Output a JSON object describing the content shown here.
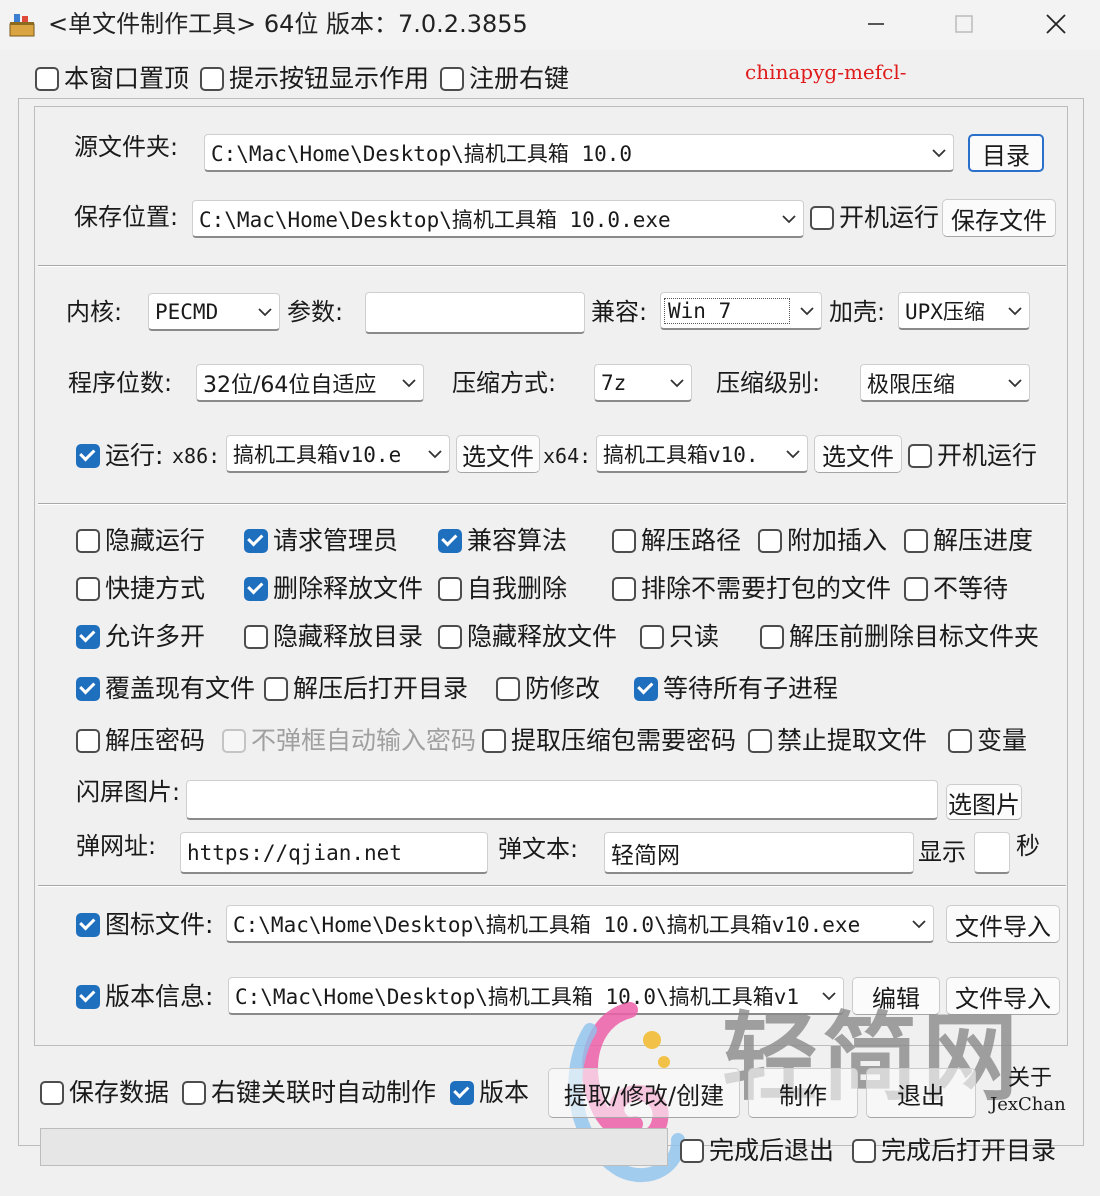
{
  "window": {
    "title": "<单文件制作工具> 64位 版本：7.0.2.3855",
    "app_icon": "app-tool-icon",
    "controls": [
      "minimize-icon",
      "maximize-icon",
      "close-icon"
    ]
  },
  "top_options": {
    "always_on_top": {
      "label": "本窗口置顶",
      "checked": false
    },
    "show_tips": {
      "label": "提示按钮显示作用",
      "checked": false
    },
    "register_context_menu": {
      "label": "注册右键",
      "checked": false
    }
  },
  "watermark_text": "chinapyg-mefcl-",
  "source": {
    "label": "源文件夹:",
    "value": "C:\\Mac\\Home\\Desktop\\搞机工具箱 10.0",
    "browse_label": "目录"
  },
  "save": {
    "label": "保存位置:",
    "value": "C:\\Mac\\Home\\Desktop\\搞机工具箱 10.0.exe",
    "autorun": {
      "label": "开机运行",
      "checked": false
    },
    "save_file_label": "保存文件"
  },
  "kernel": {
    "label": "内核:",
    "value": "PECMD"
  },
  "params": {
    "label": "参数:",
    "value": ""
  },
  "compat": {
    "label": "兼容:",
    "value": "Win 7"
  },
  "shell": {
    "label": "加壳:",
    "value": "UPX压缩"
  },
  "bits": {
    "label": "程序位数:",
    "value": "32位/64位自适应"
  },
  "compress_method": {
    "label": "压缩方式:",
    "value": "7z"
  },
  "compress_level": {
    "label": "压缩级别:",
    "value": "极限压缩"
  },
  "run": {
    "label": "运行:",
    "checked": true,
    "x86_label": "x86:",
    "x86_value": "搞机工具箱v10.e",
    "pick1_label": "选文件",
    "x64_label": "x64:",
    "x64_value": "搞机工具箱v10.",
    "pick2_label": "选文件",
    "autorun": {
      "label": "开机运行",
      "checked": false
    }
  },
  "options": {
    "hidden_run": {
      "label": "隐藏运行",
      "checked": false
    },
    "request_admin": {
      "label": "请求管理员",
      "checked": true
    },
    "compat_algo": {
      "label": "兼容算法",
      "checked": true
    },
    "extract_path": {
      "label": "解压路径",
      "checked": false
    },
    "append_insert": {
      "label": "附加插入",
      "checked": false
    },
    "extract_progress": {
      "label": "解压进度",
      "checked": false
    },
    "shortcut": {
      "label": "快捷方式",
      "checked": false
    },
    "delete_released": {
      "label": "删除释放文件",
      "checked": true
    },
    "self_delete": {
      "label": "自我删除",
      "checked": false
    },
    "exclude_files": {
      "label": "排除不需要打包的文件",
      "checked": false
    },
    "no_wait": {
      "label": "不等待",
      "checked": false
    },
    "allow_multi": {
      "label": "允许多开",
      "checked": true
    },
    "hide_release_dir": {
      "label": "隐藏释放目录",
      "checked": false
    },
    "hide_release_file": {
      "label": "隐藏释放文件",
      "checked": false
    },
    "readonly": {
      "label": "只读",
      "checked": false
    },
    "delete_target_before": {
      "label": "解压前删除目标文件夹",
      "checked": false
    },
    "overwrite": {
      "label": "覆盖现有文件",
      "checked": true
    },
    "open_dir_after": {
      "label": "解压后打开目录",
      "checked": false
    },
    "anti_modify": {
      "label": "防修改",
      "checked": false
    },
    "wait_children": {
      "label": "等待所有子进程",
      "checked": true
    },
    "extract_password": {
      "label": "解压密码",
      "checked": false
    },
    "auto_password": {
      "label": "不弹框自动输入密码",
      "checked": false
    },
    "extract_need_password": {
      "label": "提取压缩包需要密码",
      "checked": false
    },
    "forbid_extract": {
      "label": "禁止提取文件",
      "checked": false
    },
    "variable": {
      "label": "变量",
      "checked": false
    }
  },
  "splash": {
    "label": "闪屏图片:",
    "value": "",
    "pick_label": "选图片"
  },
  "popup_url": {
    "label": "弹网址:",
    "value": "https://qjian.net"
  },
  "popup_text": {
    "label": "弹文本:",
    "value": "轻简网"
  },
  "show_secs": {
    "label": "显示",
    "value": "",
    "unit": "秒"
  },
  "icon_file": {
    "label": "图标文件:",
    "checked": true,
    "value": "C:\\Mac\\Home\\Desktop\\搞机工具箱 10.0\\搞机工具箱v10.exe",
    "import_label": "文件导入"
  },
  "version_info": {
    "label": "版本信息:",
    "checked": true,
    "value": "C:\\Mac\\Home\\Desktop\\搞机工具箱 10.0\\搞机工具箱v1",
    "edit_label": "编辑",
    "import_label": "文件导入"
  },
  "bottom": {
    "save_data": {
      "label": "保存数据",
      "checked": false
    },
    "context_auto": {
      "label": "右键关联时自动制作",
      "checked": false
    },
    "version": {
      "label": "版本",
      "checked": true
    },
    "extract_modify_label": "提取/修改/创建",
    "make_label": "制作",
    "exit_label": "退出",
    "about_label": "关于",
    "author": "JexChan",
    "exit_after": {
      "label": "完成后退出",
      "checked": false
    },
    "open_after": {
      "label": "完成后打开目录",
      "checked": false
    }
  },
  "logo": {
    "text": "轻简网",
    "icon": "qjian-logo-icon",
    "color": "#8a8a8a",
    "pink": "#ec5fa8",
    "blue": "#8fc3ee",
    "yellow": "#f2c248"
  }
}
